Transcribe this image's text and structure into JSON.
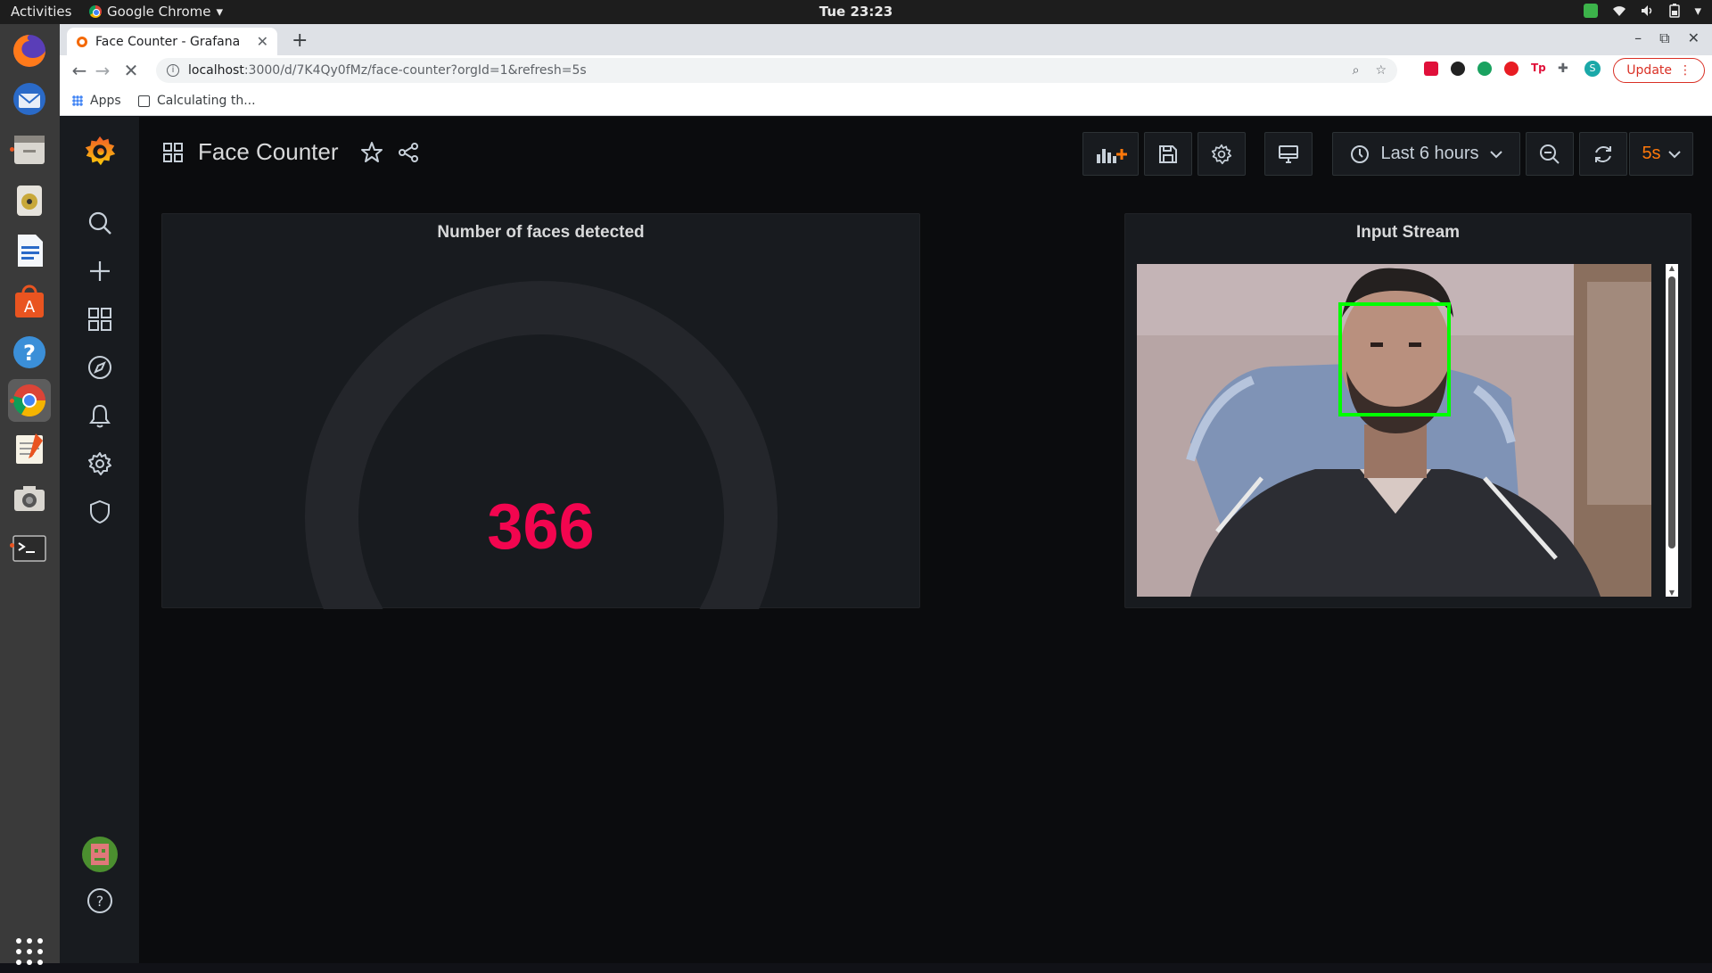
{
  "system_bar": {
    "activities": "Activities",
    "app_name": "Google Chrome",
    "clock": "Tue 23:23"
  },
  "dock": {
    "apps": [
      "firefox",
      "thunderbird",
      "files",
      "rhythmbox",
      "libreoffice-writer",
      "software-center",
      "help",
      "chrome",
      "text-editor",
      "screenshot",
      "terminal",
      "show-apps"
    ]
  },
  "browser": {
    "tab_title": "Face Counter - Grafana",
    "url_host": "localhost",
    "url_path": ":3000/d/7K4Qy0fMz/face-counter?orgId=1&refresh=5s",
    "update_label": "Update",
    "profile_initial": "S",
    "bookmarks": {
      "apps": "Apps",
      "item1": "Calculating th..."
    }
  },
  "dashboard": {
    "title": "Face Counter",
    "time_range": "Last 6 hours",
    "refresh_interval": "5s",
    "panels": {
      "gauge": {
        "title": "Number of faces detected",
        "value": "366",
        "value_color": "#f2054f"
      },
      "stream": {
        "title": "Input Stream"
      }
    }
  },
  "colors": {
    "grafana_bg": "#0b0c0e",
    "panel_bg": "#181b1f",
    "accent_orange": "#ff780a",
    "face_box": "#00ff00"
  }
}
